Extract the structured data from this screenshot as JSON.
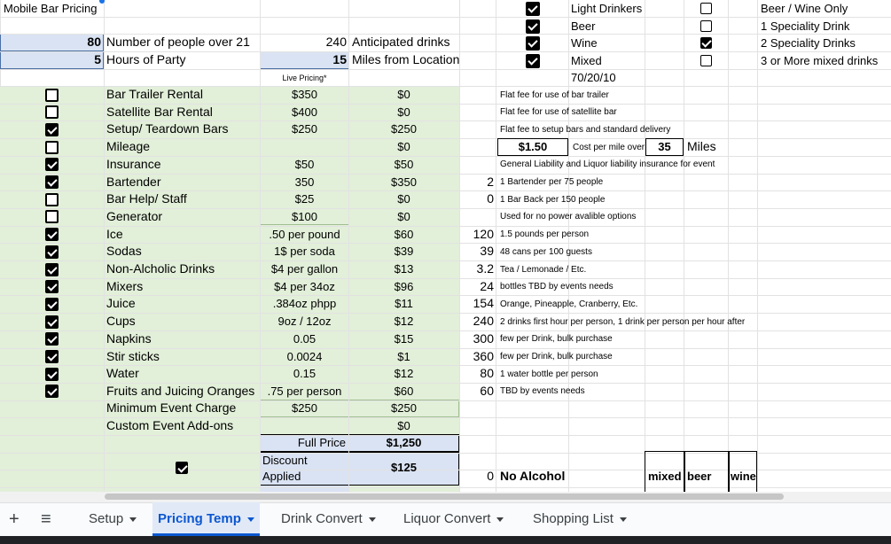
{
  "sheet": {
    "a1_title": "Mobile Bar Pricing",
    "people": {
      "value": "80",
      "label": "Number of people over 21"
    },
    "hours": {
      "value": "5",
      "label": "Hours of Party"
    },
    "anticipated": {
      "value": "240",
      "label": "Anticipated drinks"
    },
    "miles": {
      "value": "15",
      "label": "Miles from Location"
    },
    "live_pricing_header": "Live Pricing*",
    "drink_types": [
      {
        "label": "Light Drinkers",
        "checked": true
      },
      {
        "label": "Beer",
        "checked": true
      },
      {
        "label": "Wine",
        "checked": true
      },
      {
        "label": "Mixed",
        "checked": true
      }
    ],
    "date_value": "70/20/10",
    "drink_options": [
      {
        "label": "Beer / Wine Only",
        "checked": false
      },
      {
        "label": "1 Speciality Drink",
        "checked": false
      },
      {
        "label": "2 Speciality Drinks",
        "checked": true
      },
      {
        "label": "3 or More mixed drinks",
        "checked": false
      }
    ],
    "items": [
      {
        "checked": false,
        "name": "Bar Trailer Rental",
        "rate": "$350",
        "cost": "$0",
        "qty": "",
        "note": "Flat fee for use of bar trailer"
      },
      {
        "checked": false,
        "name": "Satellite  Bar Rental",
        "rate": "$400",
        "cost": "$0",
        "qty": "",
        "note": "Flat fee for use of satellite bar"
      },
      {
        "checked": true,
        "name": "Setup/ Teardown Bars",
        "rate": "$250",
        "cost": "$250",
        "qty": "",
        "note": "Flat fee to setup bars and standard delivery"
      },
      {
        "checked": false,
        "name": "Mileage",
        "rate": "",
        "cost": "$0",
        "qty": "",
        "note": ""
      },
      {
        "checked": true,
        "name": "Insurance",
        "rate": "$50",
        "cost": "$50",
        "qty": "",
        "note": "General Liability and Liquor liability insurance for event"
      },
      {
        "checked": true,
        "name": "Bartender",
        "rate": "350",
        "cost": "$350",
        "qty": "2",
        "note": "1 Bartender per 75 people"
      },
      {
        "checked": false,
        "name": "Bar Help/ Staff",
        "rate": "$25",
        "cost": "$0",
        "qty": "0",
        "note": "1 Bar Back per 150 people"
      },
      {
        "checked": false,
        "name": "Generator",
        "rate": "$100",
        "cost": "$0",
        "qty": "",
        "note": "Used for no power avalible options"
      },
      {
        "checked": true,
        "name": "Ice",
        "rate": ".50 per pound",
        "cost": "$60",
        "qty": "120",
        "note": "1.5 pounds per person"
      },
      {
        "checked": true,
        "name": "Sodas",
        "rate": "1$ per soda",
        "cost": "$39",
        "qty": "39",
        "note": "48 cans per 100 guests"
      },
      {
        "checked": true,
        "name": "Non-Alcholic Drinks",
        "rate": "$4 per gallon",
        "cost": "$13",
        "qty": "3.2",
        "note": "Tea / Lemonade / Etc."
      },
      {
        "checked": true,
        "name": "Mixers",
        "rate": "$4 per 34oz",
        "cost": "$96",
        "qty": "24",
        "note": "bottles TBD by events needs"
      },
      {
        "checked": true,
        "name": "Juice",
        "rate": ".384oz phpp",
        "cost": "$11",
        "qty": "154",
        "note": "Orange, Pineapple, Cranberry, Etc."
      },
      {
        "checked": true,
        "name": "Cups",
        "rate": "9oz / 12oz",
        "cost": "$12",
        "qty": "240",
        "note": "2 drinks first hour per person, 1 drink per person per hour after"
      },
      {
        "checked": true,
        "name": "Napkins",
        "rate": "0.05",
        "cost": "$15",
        "qty": "300",
        "note": "few per Drink, bulk purchase"
      },
      {
        "checked": true,
        "name": "Stir sticks",
        "rate": "0.0024",
        "cost": "$1",
        "qty": "360",
        "note": "few per Drink, bulk purchase"
      },
      {
        "checked": true,
        "name": "Water",
        "rate": "0.15",
        "cost": "$12",
        "qty": "80",
        "note": "1 water bottle per person"
      },
      {
        "checked": true,
        "name": "Fruits and Juicing Oranges",
        "rate": ".75 per person",
        "cost": "$60",
        "qty": "60",
        "note": "TBD by events needs"
      }
    ],
    "mileage_rate": "$1.50",
    "mileage_rate_label": "Cost per mile over",
    "mileage_threshold": "35",
    "mileage_unit": "Miles",
    "min_charge": {
      "label": "Minimum Event Charge",
      "rate": "$250",
      "cost": "$250"
    },
    "custom_addons": {
      "label": "Custom Event Add-ons",
      "cost": "$0"
    },
    "full_price": {
      "label": "Full Price",
      "value": "$1,250"
    },
    "discount": {
      "label": "Discount Applied",
      "value": "$125",
      "checked": true
    },
    "no_alcohol": {
      "qty": "0",
      "label": "No Alcohol"
    },
    "mini_table_headers": [
      "mixed",
      "beer",
      "wine"
    ]
  },
  "tabs": [
    {
      "label": "Setup",
      "active": false
    },
    {
      "label": "Pricing Temp",
      "active": true
    },
    {
      "label": "Drink Convert",
      "active": false
    },
    {
      "label": "Liquor Convert",
      "active": false
    },
    {
      "label": "Shopping List",
      "active": false
    }
  ],
  "colors": {
    "green_fill": "#e2efd9",
    "blue_fill": "#dae3f3",
    "active_tab": "#0b57d0"
  }
}
